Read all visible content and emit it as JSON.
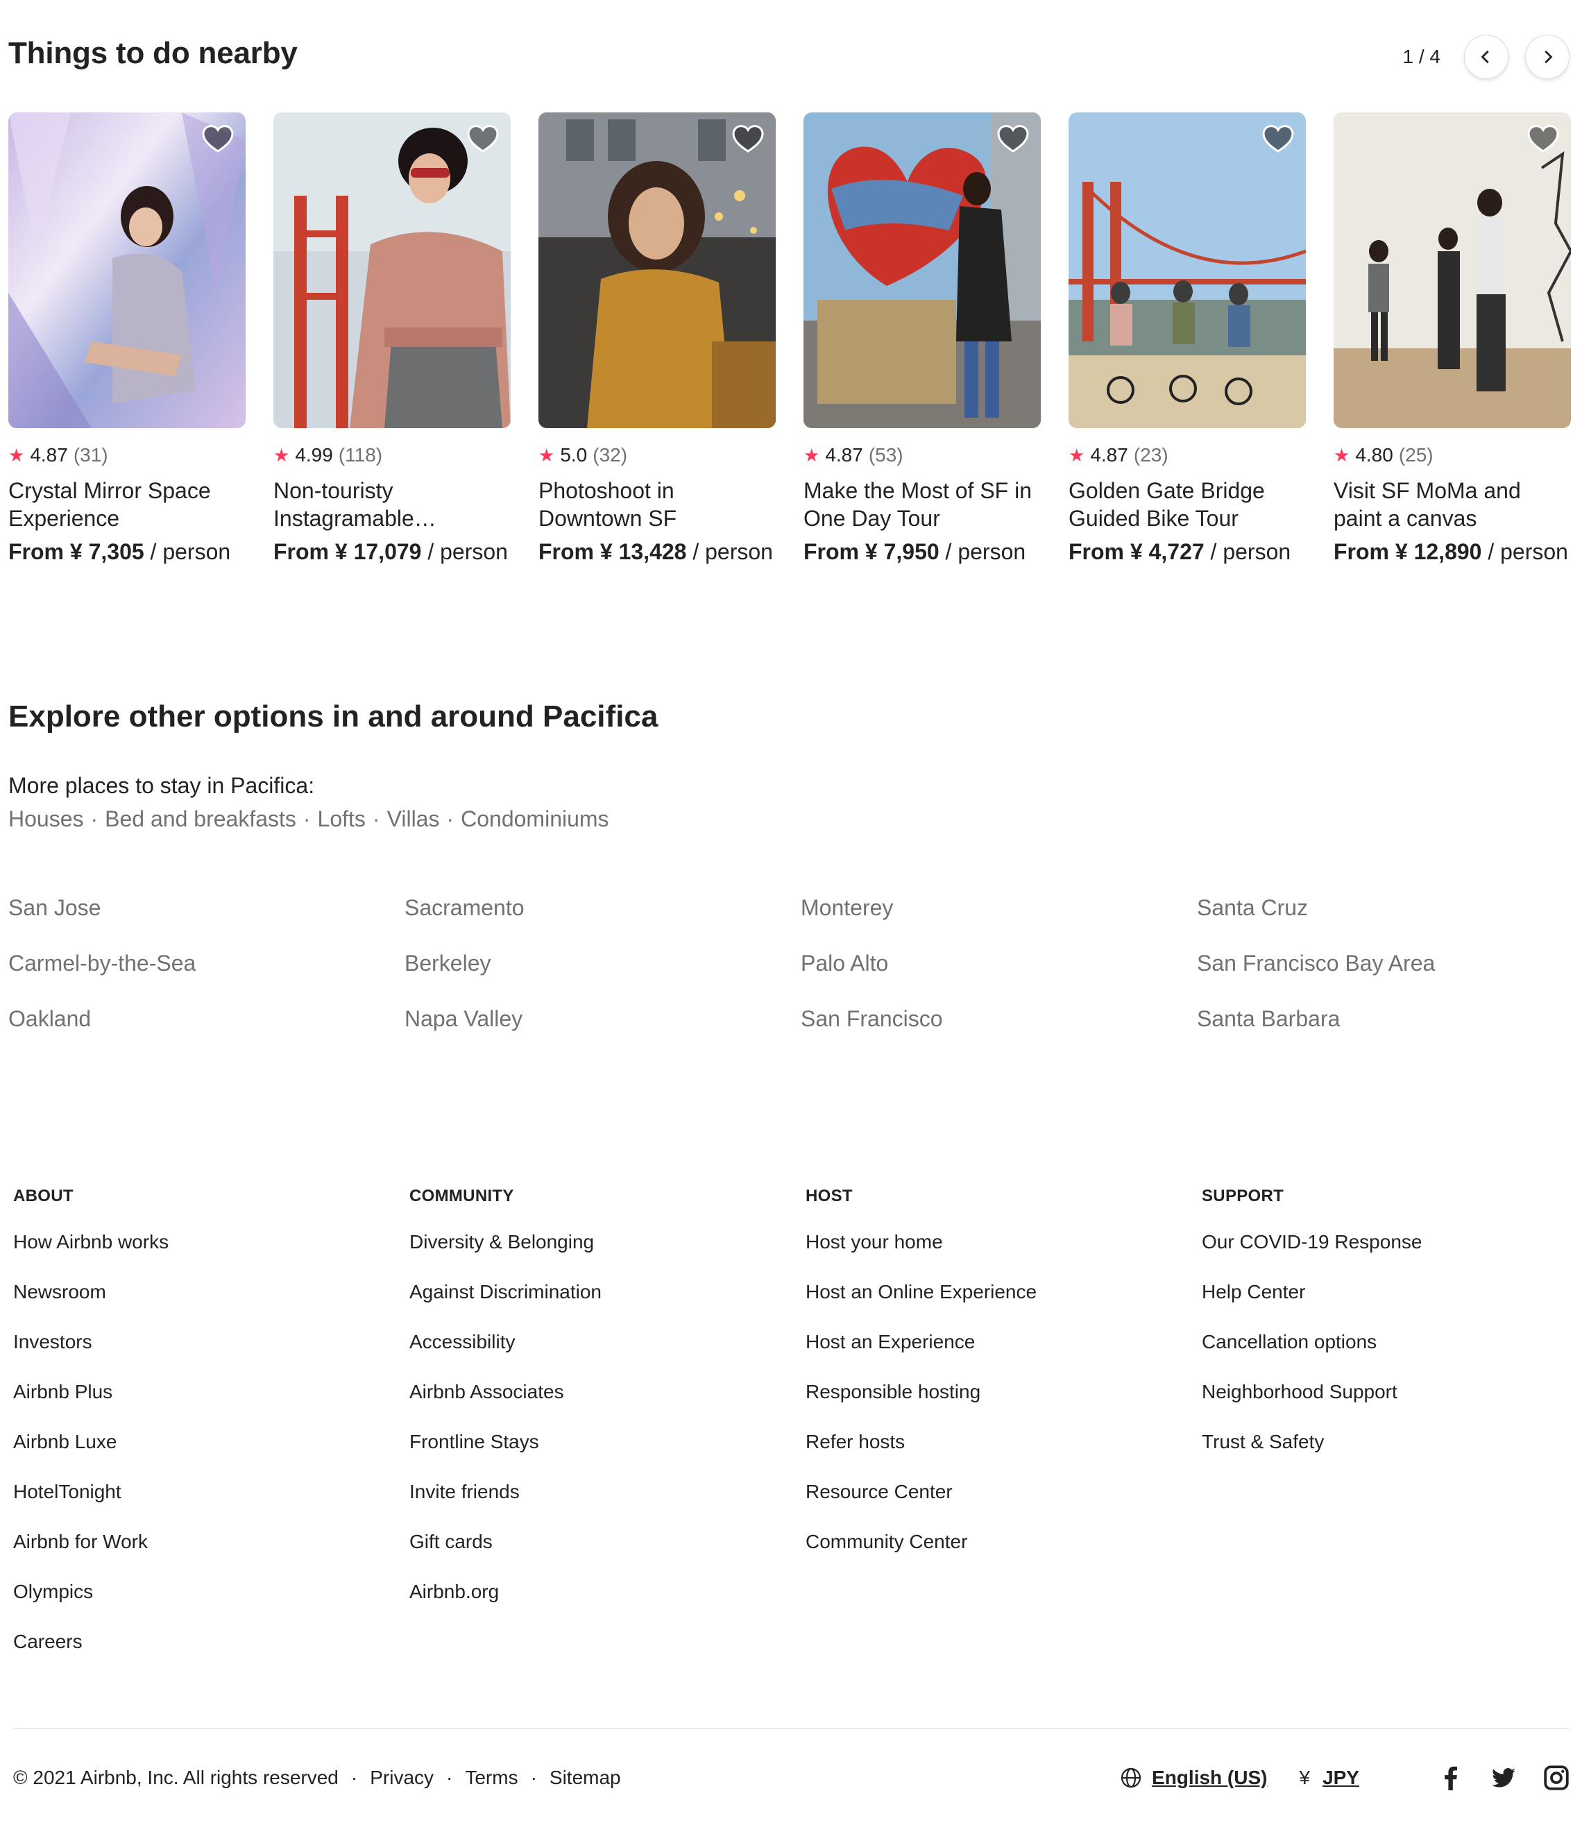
{
  "things_to_do": {
    "title": "Things to do nearby",
    "pager": "1 / 4",
    "cards": [
      {
        "rating": "4.87",
        "count": "(31)",
        "title": "Crystal Mirror Space Experience",
        "price_from": "From ¥ 7,305",
        "price_unit": " / person"
      },
      {
        "rating": "4.99",
        "count": "(118)",
        "title": "Non-touristy Instagramable…",
        "price_from": "From ¥ 17,079",
        "price_unit": " / person"
      },
      {
        "rating": "5.0",
        "count": "(32)",
        "title": "Photoshoot in Downtown SF",
        "price_from": "From ¥ 13,428",
        "price_unit": " / person"
      },
      {
        "rating": "4.87",
        "count": "(53)",
        "title": "Make the Most of SF in One Day Tour",
        "price_from": "From ¥ 7,950",
        "price_unit": " / person"
      },
      {
        "rating": "4.87",
        "count": "(23)",
        "title": "Golden Gate Bridge Guided Bike Tour",
        "price_from": "From ¥ 4,727",
        "price_unit": " / person"
      },
      {
        "rating": "4.80",
        "count": "(25)",
        "title": "Visit SF MoMa and paint a canvas",
        "price_from": "From ¥ 12,890",
        "price_unit": " / person"
      }
    ],
    "star_color": "#FF385C"
  },
  "explore": {
    "title": "Explore other options in and around Pacifica",
    "more_label": "More places to stay in Pacifica:",
    "place_types": [
      "Houses",
      "Bed and breakfasts",
      "Lofts",
      "Villas",
      "Condominiums"
    ],
    "separator": "·",
    "cities": [
      "San Jose",
      "Sacramento",
      "Monterey",
      "Santa Cruz",
      "Carmel-by-the-Sea",
      "Berkeley",
      "Palo Alto",
      "San Francisco Bay Area",
      "Oakland",
      "Napa Valley",
      "San Francisco",
      "Santa Barbara"
    ]
  },
  "footer": {
    "columns": [
      {
        "heading": "ABOUT",
        "links": [
          "How Airbnb works",
          "Newsroom",
          "Investors",
          "Airbnb Plus",
          "Airbnb Luxe",
          "HotelTonight",
          "Airbnb for Work",
          "Olympics",
          "Careers"
        ]
      },
      {
        "heading": "COMMUNITY",
        "links": [
          "Diversity & Belonging",
          "Against Discrimination",
          "Accessibility",
          "Airbnb Associates",
          "Frontline Stays",
          "Invite friends",
          "Gift cards",
          "Airbnb.org"
        ]
      },
      {
        "heading": "HOST",
        "links": [
          "Host your home",
          "Host an Online Experience",
          "Host an Experience",
          "Responsible hosting",
          "Refer hosts",
          "Resource Center",
          "Community Center"
        ]
      },
      {
        "heading": "SUPPORT",
        "links": [
          "Our COVID-19 Response",
          "Help Center",
          "Cancellation options",
          "Neighborhood Support",
          "Trust & Safety"
        ]
      }
    ],
    "copyright": "© 2021 Airbnb, Inc. All rights reserved",
    "dot": "·",
    "privacy": "Privacy",
    "terms": "Terms",
    "sitemap": "Sitemap",
    "language": "English (US)",
    "currency_symbol": "¥",
    "currency": "JPY",
    "social_icons": [
      "facebook-icon",
      "twitter-icon",
      "instagram-icon"
    ]
  }
}
